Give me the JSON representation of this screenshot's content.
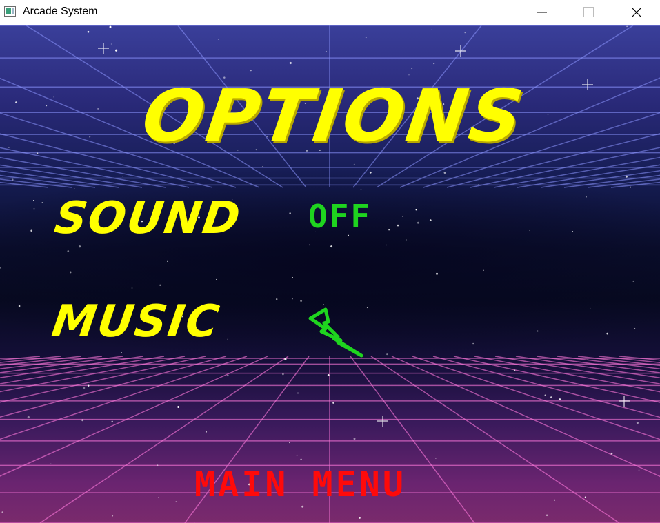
{
  "window": {
    "title": "Arcade System",
    "controls": [
      "minimize",
      "maximize",
      "close"
    ]
  },
  "screen": {
    "heading": "OPTIONS",
    "options": [
      {
        "label": "SOUND",
        "value": "OFF"
      },
      {
        "label": "MUSIC",
        "value_icon": "lightning-bolt-icon"
      }
    ],
    "main_menu_label": "MAIN MENU"
  },
  "colors": {
    "heading": "#ffff00",
    "option_label": "#ffff00",
    "option_value": "#1fd41f",
    "main_menu": "#ff0a0a",
    "grid_top": "#7f8bff",
    "grid_bottom": "#ff6fd8"
  }
}
